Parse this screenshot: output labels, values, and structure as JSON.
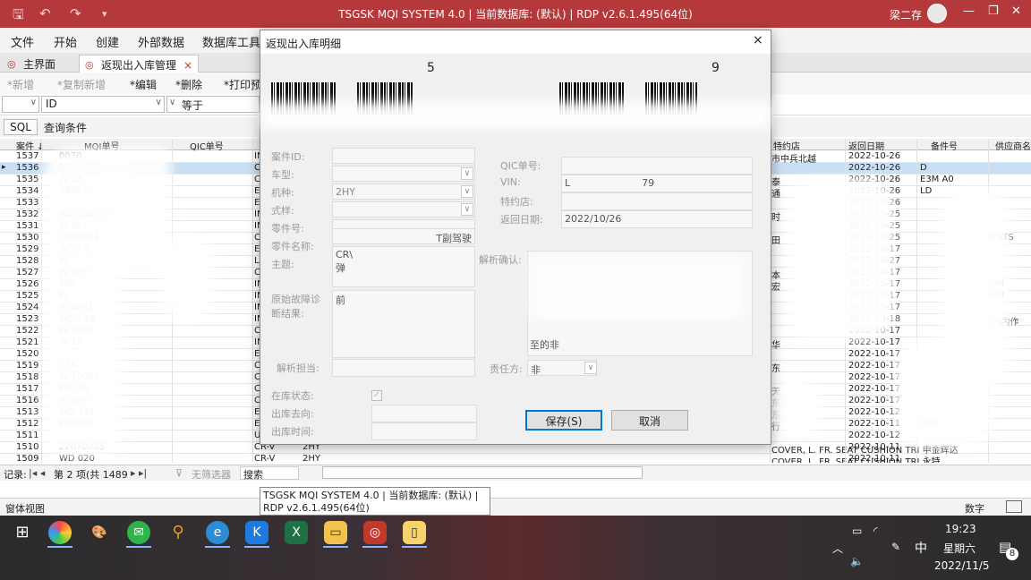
{
  "app": {
    "title": "TSGSK MQI SYSTEM 4.0 | 当前数据库: (默认) | RDP v2.6.1.495(64位)",
    "user": "梁二存"
  },
  "menu": [
    "文件",
    "开始",
    "创建",
    "外部数据",
    "数据库工具"
  ],
  "tabs": [
    {
      "label": "主界面"
    },
    {
      "label": "返现出入库管理",
      "close": "×"
    }
  ],
  "toolbar": {
    "new": "*新增",
    "copy_new": "*复制新增",
    "edit": "*编辑",
    "delete": "*删除",
    "print": "*打印预"
  },
  "filter": {
    "field": "ID",
    "operator": "等于"
  },
  "sql": {
    "button": "SQL",
    "label": "查询条件"
  },
  "grid": {
    "headers": [
      "案件 ↓",
      "MQI单号",
      "QIC单号",
      "特约店",
      "返回日期",
      "备件号",
      "供应商名"
    ],
    "rows": [
      [
        "1537",
        "0070",
        "IN",
        "市中兵北越",
        "2022-10-26",
        "",
        ""
      ],
      [
        "1536",
        "5",
        "C",
        "",
        "2022-10-26",
        "D",
        ""
      ],
      [
        "1535",
        "W 28",
        "C",
        "泰",
        "2022-10-26",
        "E3M A0",
        ""
      ],
      [
        "1534",
        "080010",
        "E",
        "通",
        "2022-10-26",
        "LD",
        ""
      ],
      [
        "1533",
        "",
        "E",
        "",
        "2022-10-26",
        "",
        ""
      ],
      [
        "1532",
        "WDGD010X",
        "IN",
        "时",
        "2022-10-25",
        "",
        ""
      ],
      [
        "1531",
        "W 007",
        "IN",
        "",
        "2022-10-25",
        "",
        ""
      ],
      [
        "1530",
        "2050344",
        "C",
        "田",
        "2022-10-25",
        "",
        "XGTS"
      ],
      [
        "1529",
        "WDG 9",
        "E",
        "",
        "2022-10-17",
        "",
        ""
      ],
      [
        "1528",
        "W",
        "L",
        "",
        "2022-10-27",
        "",
        ""
      ],
      [
        "1527",
        "W 009",
        "C",
        "本",
        "2022-10-17",
        "",
        ""
      ],
      [
        "1526",
        "WD",
        "IN",
        "宏",
        "2022-10-17",
        "",
        "HM"
      ],
      [
        "1525",
        "W",
        "IN",
        "",
        "2022-10-17",
        "",
        "HM"
      ],
      [
        "1524",
        "W 0061",
        "IN",
        "",
        "2022-10-17",
        "",
        ""
      ],
      [
        "1523",
        "WDS 49",
        "IN",
        "",
        "2022-10-18",
        "",
        "TS内作"
      ],
      [
        "1522",
        "W 0068",
        "C",
        "",
        "2022-10-17",
        "",
        ""
      ],
      [
        "1521",
        "W 16",
        "IN",
        "华",
        "2022-10-17",
        "",
        ""
      ],
      [
        "1520",
        "",
        "E",
        "",
        "2022-10-17",
        "",
        ""
      ],
      [
        "1519",
        "174",
        "C",
        "东",
        "2022-10-17",
        "",
        ""
      ],
      [
        "1518",
        "W 70064",
        "C",
        "",
        "2022-10-17",
        "",
        ""
      ],
      [
        "1517",
        "WD 89",
        "C",
        "天",
        "2022-10-17",
        "",
        ""
      ],
      [
        "1516",
        "W 095",
        "C",
        "东",
        "2022-10-17",
        "",
        ""
      ],
      [
        "1513",
        "WD 134",
        "E",
        "东",
        "2022-10-12",
        "",
        ""
      ],
      [
        "1512",
        "WDSD0",
        "E",
        "行",
        "2022-10-11",
        "UR0",
        ""
      ],
      [
        "1511",
        "",
        "U",
        "",
        "2022-10-12",
        "",
        ""
      ],
      [
        "1510",
        "22070085",
        "CR-V",
        "COVER, L. FR. SEAT CUSHION TRI 申金辉达",
        "2022-10-11",
        "",
        ""
      ],
      [
        "1509",
        "WD 020",
        "CR-V",
        "COVER, L. FR. SEAT CUSHION TRI 永特",
        "2022-10-11",
        "",
        ""
      ]
    ],
    "extra_col": {
      "r1510": "2HY",
      "r1509": "2HY"
    }
  },
  "record": {
    "label": "记录:",
    "nav": "|◂ ◂",
    "pos": "第 2 项(共 1489",
    "nav2": "▸ ▸|",
    "nofilter": "无筛选器",
    "search": "搜索"
  },
  "status": {
    "left": "窗体视图",
    "right": "数字"
  },
  "tooltip": "TSGSK MQI SYSTEM 4.0 | 当前数据库: (默认) | RDP v2.6.1.495(64位)",
  "dialog": {
    "title": "返现出入库明细",
    "close": "×",
    "barcode_digit_left": "5",
    "barcode_digit_right": "9",
    "labels": {
      "case_id": "案件ID:",
      "car_type": "车型:",
      "model": "机种:",
      "style": "式样:",
      "part_no": "零件号:",
      "part_name": "零件名称:",
      "subject": "主题:",
      "diag": "原始故障诊断结果:",
      "analyst": "解析担当:",
      "in_stock": "在库状态:",
      "out_dest": "出库去向:",
      "out_time": "出库时间:",
      "qic": "QIC单号:",
      "vin": "VIN:",
      "dealer": "特约店:",
      "return_date": "返回日期:",
      "confirm": "解析确认:",
      "resp": "责任方:"
    },
    "values": {
      "model": "2HY",
      "part_name_tail": "T副驾驶",
      "subject_1": "CR\\",
      "subject_2": "弹",
      "diag": "前",
      "vin_head": "L",
      "vin_tail": "79",
      "return_date": "2022/10/26",
      "resp": "非",
      "confirm_tail": "至的非"
    },
    "save": "保存(S)",
    "cancel": "取消"
  },
  "taskbar": {
    "time": "19:23",
    "weekday": "星期六",
    "date": "2022/11/5",
    "ime": "中",
    "badge": "8"
  }
}
